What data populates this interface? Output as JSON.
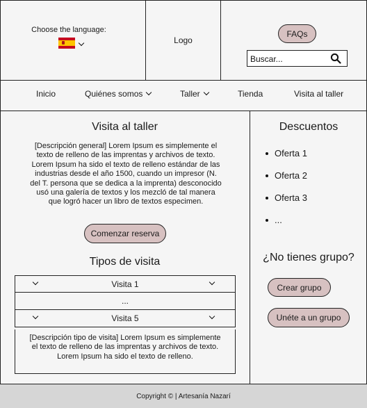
{
  "header": {
    "language_label": "Choose the language:",
    "language_flag": "spain-flag-icon",
    "logo_text": "Logo",
    "faqs_label": "FAQs",
    "search_placeholder": "Buscar...",
    "search_icon": "search-icon"
  },
  "nav": {
    "items": [
      {
        "label": "Inicio"
      },
      {
        "label": "Quiénes somos",
        "dropdown": true
      },
      {
        "label": "Taller",
        "dropdown": true
      },
      {
        "label": "Tienda"
      },
      {
        "label": "Visita al taller"
      }
    ]
  },
  "main": {
    "title": "Visita al taller",
    "description": "[Descripción general] Lorem Ipsum es simplemente el texto de relleno de las imprentas y archivos de texto. Lorem Ipsum ha sido el texto de relleno estándar de las industrias desde el año 1500, cuando un impresor (N. del T. persona que se dedica a la imprenta) desconocido usó una galería de textos y los mezcló de tal manera que logró hacer un libro de textos especimen.",
    "book_button": "Comenzar reserva",
    "types_title": "Tipos de visita",
    "accordion": [
      {
        "label": "Visita 1"
      },
      {
        "label": "..."
      },
      {
        "label": "Visita 5"
      }
    ],
    "visit_description": "[Descripción tipo de visita] Lorem Ipsum es simplemente el texto de relleno de las imprentas y archivos de texto. Lorem Ipsum ha sido el texto de relleno."
  },
  "sidebar": {
    "discounts_title": "Descuentos",
    "offers": [
      "Oferta 1",
      "Oferta 2",
      "Oferta 3",
      "..."
    ],
    "group_question": "¿No tienes grupo?",
    "create_group": "Crear grupo",
    "join_group": "Unéte a un grupo"
  },
  "footer": {
    "copyright": "Copyright © | Artesanía Nazarí"
  },
  "colors": {
    "button_fill": "#d7c1c1",
    "footer_bg": "#d6d6d6",
    "page_bg": "#f5f5f5"
  }
}
